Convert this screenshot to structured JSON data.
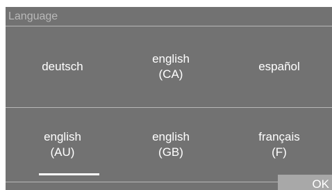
{
  "screen": {
    "title": "Language"
  },
  "options": [
    {
      "line1": "deutsch",
      "line2": ""
    },
    {
      "line1": "english",
      "line2": "(CA)"
    },
    {
      "line1": "español",
      "line2": ""
    },
    {
      "line1": "english",
      "line2": "(AU)"
    },
    {
      "line1": "english",
      "line2": "(GB)"
    },
    {
      "line1": "français",
      "line2": "(F)"
    }
  ],
  "selected_option": "english (AU)",
  "footer": {
    "ok_label": "OK"
  },
  "colors": {
    "panel_background": "#727272",
    "title_text": "#b9b9b9",
    "divider": "#b8b8b8",
    "ok_button_background": "#a8a8a8",
    "selection_indicator": "#ffffff"
  }
}
